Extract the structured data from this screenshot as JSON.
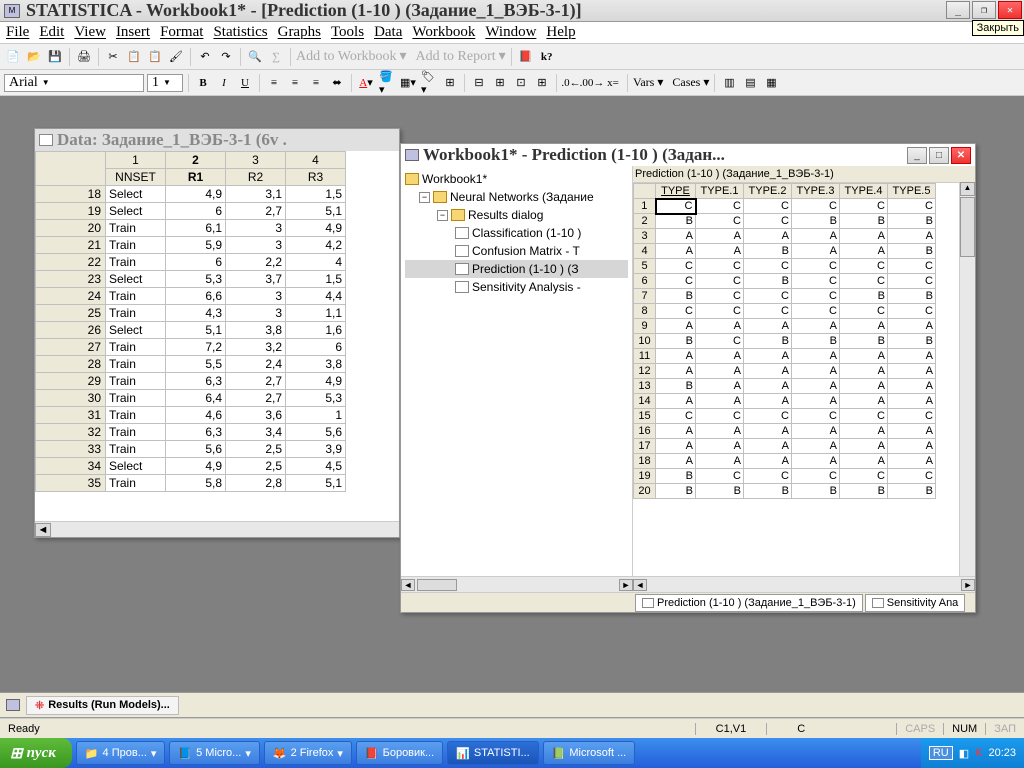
{
  "app": {
    "title": "STATISTICA - Workbook1* - [Prediction (1-10 ) (Задание_1_ВЭБ-3-1)]",
    "close_tooltip": "Закрыть"
  },
  "menu": [
    "File",
    "Edit",
    "View",
    "Insert",
    "Format",
    "Statistics",
    "Graphs",
    "Tools",
    "Data",
    "Workbook",
    "Window",
    "Help"
  ],
  "toolbar": {
    "add_wb": "Add to Workbook",
    "add_rp": "Add to Report"
  },
  "font": {
    "name": "Arial",
    "size": "1",
    "vars": "Vars",
    "cases": "Cases"
  },
  "data_window": {
    "title": "Data: Задание_1_ВЭБ-3-1 (6v .",
    "cols_num": [
      "1",
      "2",
      "3",
      "4"
    ],
    "cols_name": [
      "NNSET",
      "R1",
      "R2",
      "R3"
    ],
    "sel_col": 1,
    "rows": [
      {
        "n": "18",
        "set": "Select",
        "r1": "4,9",
        "r2": "3,1",
        "r3": "1,5"
      },
      {
        "n": "19",
        "set": "Select",
        "r1": "6",
        "r2": "2,7",
        "r3": "5,1"
      },
      {
        "n": "20",
        "set": "Train",
        "r1": "6,1",
        "r2": "3",
        "r3": "4,9"
      },
      {
        "n": "21",
        "set": "Train",
        "r1": "5,9",
        "r2": "3",
        "r3": "4,2"
      },
      {
        "n": "22",
        "set": "Train",
        "r1": "6",
        "r2": "2,2",
        "r3": "4"
      },
      {
        "n": "23",
        "set": "Select",
        "r1": "5,3",
        "r2": "3,7",
        "r3": "1,5"
      },
      {
        "n": "24",
        "set": "Train",
        "r1": "6,6",
        "r2": "3",
        "r3": "4,4"
      },
      {
        "n": "25",
        "set": "Train",
        "r1": "4,3",
        "r2": "3",
        "r3": "1,1"
      },
      {
        "n": "26",
        "set": "Select",
        "r1": "5,1",
        "r2": "3,8",
        "r3": "1,6"
      },
      {
        "n": "27",
        "set": "Train",
        "r1": "7,2",
        "r2": "3,2",
        "r3": "6"
      },
      {
        "n": "28",
        "set": "Train",
        "r1": "5,5",
        "r2": "2,4",
        "r3": "3,8"
      },
      {
        "n": "29",
        "set": "Train",
        "r1": "6,3",
        "r2": "2,7",
        "r3": "4,9"
      },
      {
        "n": "30",
        "set": "Train",
        "r1": "6,4",
        "r2": "2,7",
        "r3": "5,3"
      },
      {
        "n": "31",
        "set": "Train",
        "r1": "4,6",
        "r2": "3,6",
        "r3": "1"
      },
      {
        "n": "32",
        "set": "Train",
        "r1": "6,3",
        "r2": "3,4",
        "r3": "5,6"
      },
      {
        "n": "33",
        "set": "Train",
        "r1": "5,6",
        "r2": "2,5",
        "r3": "3,9"
      },
      {
        "n": "34",
        "set": "Select",
        "r1": "4,9",
        "r2": "2,5",
        "r3": "4,5"
      },
      {
        "n": "35",
        "set": "Train",
        "r1": "5,8",
        "r2": "2,8",
        "r3": "5,1"
      }
    ]
  },
  "wb_window": {
    "title": "Workbook1* - Prediction (1-10 ) (Задан...",
    "tree": {
      "root": "Workbook1*",
      "nn": "Neural Networks (Задание",
      "rd": "Results dialog",
      "items": [
        "Classification (1-10 )",
        "Confusion Matrix - T",
        "Prediction (1-10 ) (З",
        "Sensitivity Analysis -"
      ]
    },
    "pred_title": "Prediction (1-10 ) (Задание_1_ВЭБ-3-1)",
    "pred_cols": [
      "TYPE",
      "TYPE.1",
      "TYPE.2",
      "TYPE.3",
      "TYPE.4",
      "TYPE.5"
    ],
    "pred_rows": [
      [
        "C",
        "C",
        "C",
        "C",
        "C",
        "C"
      ],
      [
        "B",
        "C",
        "C",
        "B",
        "B",
        "B"
      ],
      [
        "A",
        "A",
        "A",
        "A",
        "A",
        "A"
      ],
      [
        "A",
        "A",
        "B",
        "A",
        "A",
        "B"
      ],
      [
        "C",
        "C",
        "C",
        "C",
        "C",
        "C"
      ],
      [
        "C",
        "C",
        "B",
        "C",
        "C",
        "C"
      ],
      [
        "B",
        "C",
        "C",
        "C",
        "B",
        "B"
      ],
      [
        "C",
        "C",
        "C",
        "C",
        "C",
        "C"
      ],
      [
        "A",
        "A",
        "A",
        "A",
        "A",
        "A"
      ],
      [
        "B",
        "C",
        "B",
        "B",
        "B",
        "B"
      ],
      [
        "A",
        "A",
        "A",
        "A",
        "A",
        "A"
      ],
      [
        "A",
        "A",
        "A",
        "A",
        "A",
        "A"
      ],
      [
        "B",
        "A",
        "A",
        "A",
        "A",
        "A"
      ],
      [
        "A",
        "A",
        "A",
        "A",
        "A",
        "A"
      ],
      [
        "C",
        "C",
        "C",
        "C",
        "C",
        "C"
      ],
      [
        "A",
        "A",
        "A",
        "A",
        "A",
        "A"
      ],
      [
        "A",
        "A",
        "A",
        "A",
        "A",
        "A"
      ],
      [
        "A",
        "A",
        "A",
        "A",
        "A",
        "A"
      ],
      [
        "B",
        "C",
        "C",
        "C",
        "C",
        "C"
      ],
      [
        "B",
        "B",
        "B",
        "B",
        "B",
        "B"
      ]
    ],
    "tab1": "Prediction (1-10 ) (Задание_1_ВЭБ-3-1)",
    "tab2": "Sensitivity Ana"
  },
  "bottom": {
    "results": "Results (Run Models)..."
  },
  "status": {
    "ready": "Ready",
    "cell": "C1,V1",
    "c": "C",
    "caps": "CAPS",
    "num": "NUM",
    "zap": "ЗАП"
  },
  "taskbar": {
    "start": "пуск",
    "items": [
      "4 Пров...",
      "5 Micro...",
      "2 Firefox",
      "Боровик...",
      "STATISTI...",
      "Microsoft ..."
    ],
    "lang": "RU",
    "time": "20:23"
  }
}
